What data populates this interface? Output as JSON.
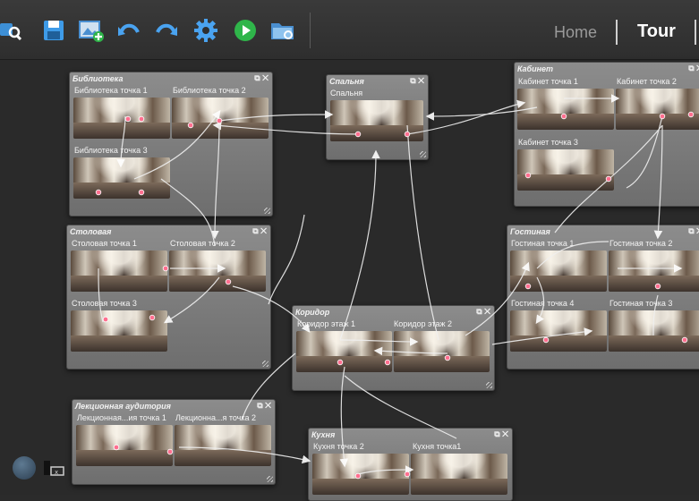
{
  "toolbar": {
    "icons": [
      "search-tour-icon",
      "save-icon",
      "add-image-icon",
      "undo-icon",
      "redo-icon",
      "settings-icon",
      "play-icon",
      "open-folder-icon"
    ],
    "nav": {
      "home": "Home",
      "tour": "Tour"
    }
  },
  "rooms": [
    {
      "title": "Библиотека",
      "labels": [
        "Библиотека точка 1",
        "Библиотека точка 2",
        "Библиотека точка 3"
      ]
    },
    {
      "title": "Спальня",
      "labels": [
        "Спальня"
      ]
    },
    {
      "title": "Кабинет",
      "labels": [
        "Кабинет точка 1",
        "Кабинет точка 2",
        "Кабинет точка 3"
      ]
    },
    {
      "title": "Столовая",
      "labels": [
        "Столовая точка 1",
        "Столовая точка 2",
        "Столовая точка 3"
      ]
    },
    {
      "title": "Гостиная",
      "labels": [
        "Гостиная точка 1",
        "Гостиная точка 2",
        "Гостиная точка 4",
        "Гостиная точка 3"
      ]
    },
    {
      "title": "Коридор",
      "labels": [
        "Коридор этаж 1",
        "Коридор этаж 2"
      ]
    },
    {
      "title": "Лекционная аудитория",
      "labels": [
        "Лекционная...ия точка 1",
        "Лекционна...я точка 2"
      ]
    },
    {
      "title": "Кухня",
      "labels": [
        "Кухня точка 2",
        "Кухня точка1"
      ]
    }
  ],
  "room_controls": "⧉ ✕",
  "colors": {
    "link": "#ffffff",
    "hotspot": "#e8607a",
    "room_bg": "#7c7c7c",
    "canvas_bg": "#2a2a2a"
  }
}
